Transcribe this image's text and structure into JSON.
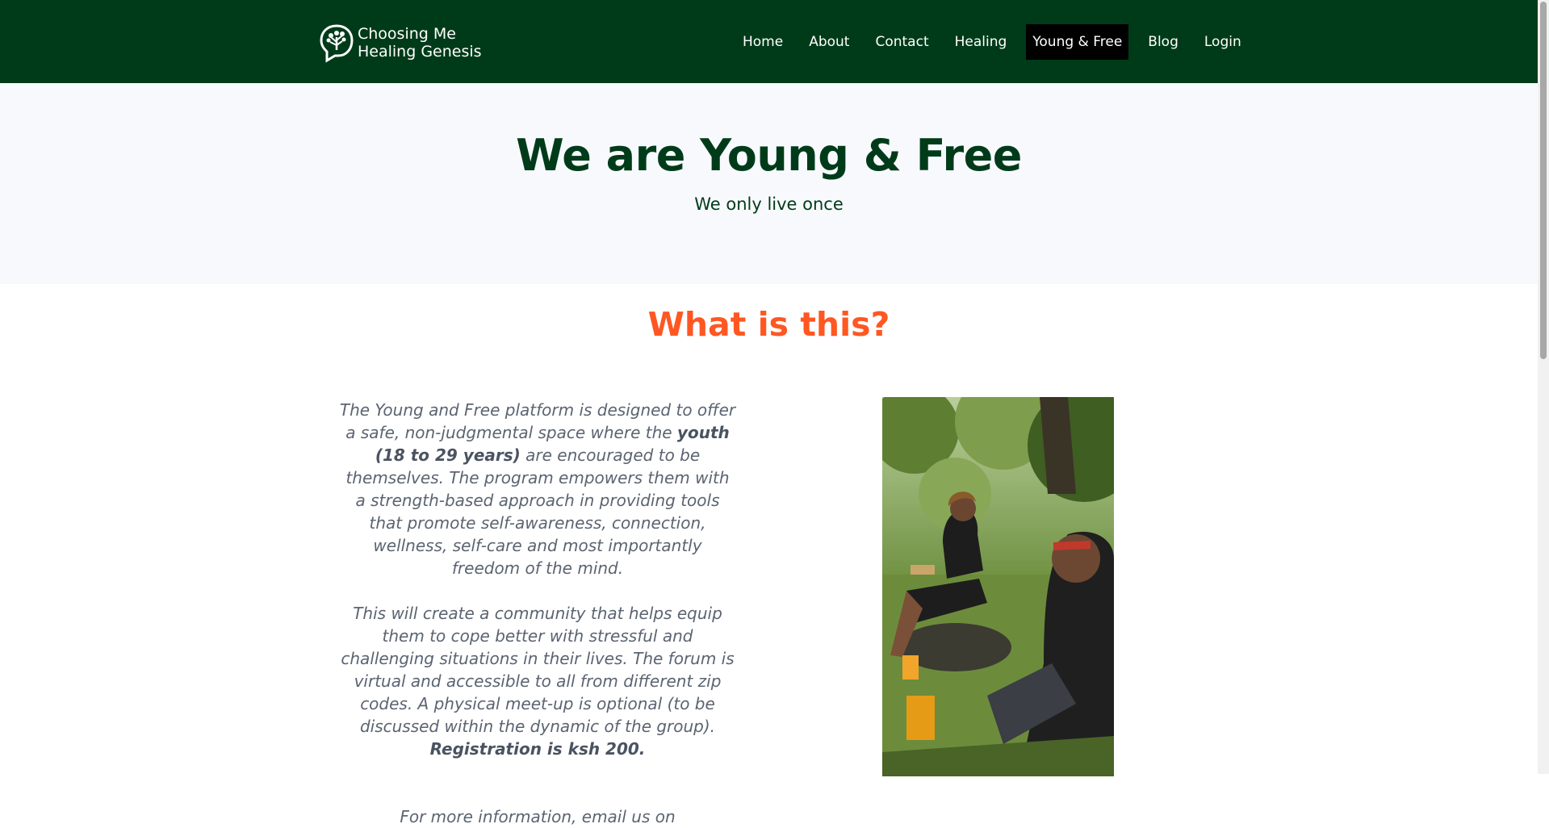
{
  "brand": {
    "line1": "Choosing Me",
    "line2": "Healing Genesis"
  },
  "nav": [
    "Home",
    "About",
    "Contact",
    "Healing",
    "Young & Free",
    "Blog",
    "Login"
  ],
  "nav_active": "Young & Free",
  "hero": {
    "title": "We are Young & Free",
    "subtitle": "We only live once"
  },
  "section": {
    "title": "What is this?",
    "p1_a": "The Young and Free platform is designed to offer a safe, non-judgmental space where the ",
    "p1_b": "youth (18 to 29 years)",
    "p1_c": " are encouraged to be themselves. The program empowers them with a strength-based approach in providing tools that promote self-awareness, connection, wellness, self-care and most importantly freedom of the mind.",
    "p2_a": "This will create a community that helps equip them to cope better with stressful and challenging situations in their lives. The forum is virtual and accessible to all from different zip codes. A physical meet-up is optional (to be discussed within the dynamic of the group). ",
    "p2_b": "Registration is ksh 200.",
    "p3": "For more information, email us on"
  },
  "colors": {
    "nav_bg": "#003b19",
    "hero_bg": "#f8f9fd",
    "accent": "#ff5722",
    "text_muted": "#5b6471"
  }
}
